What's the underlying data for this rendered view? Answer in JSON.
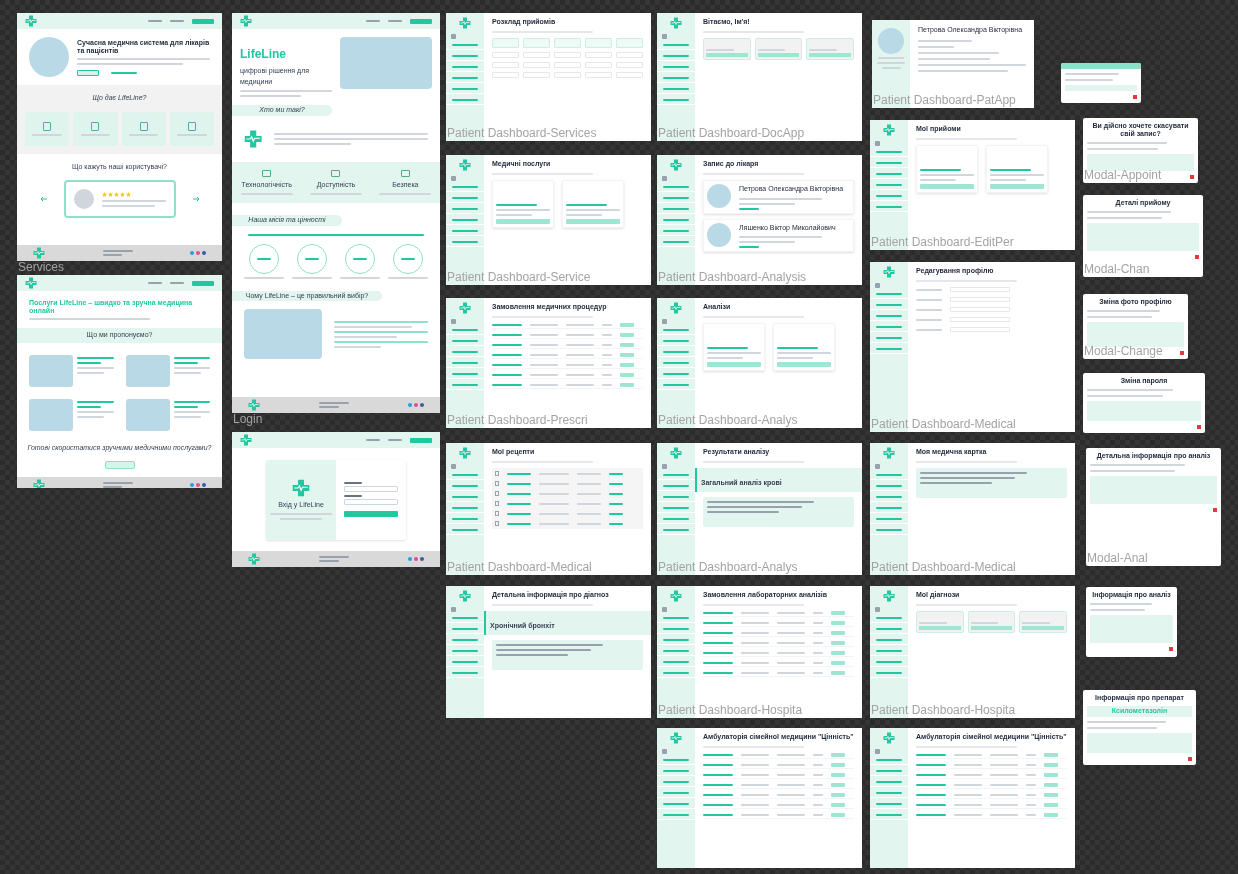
{
  "frames": [
    {
      "kind": "home",
      "label": "Services",
      "title": "Сучасна медична система для лікарів та пацієнтів",
      "section": "Що дає LifeLine?",
      "reviews_title": "Що кажуть наші користувачі?",
      "review": {
        "stars": 5
      }
    },
    {
      "kind": "services",
      "title": "Послуги LifeLine – швидко та зручна медицина онлайн",
      "section": "Що ми пропонуємо?",
      "cta": "Готові скористатися зручними медичними послугами?"
    },
    {
      "kind": "about",
      "label": "Login",
      "brand": "LifeLine",
      "tagline": "цифрові рішення для медицини",
      "who": "Хто ми такі?",
      "features": [
        "Технологічність",
        "Доступність",
        "Безпека"
      ],
      "mission": "Наша місія та цінності",
      "why": "Чому LifeLine – це правильний вибір?"
    },
    {
      "kind": "login",
      "title": "Вхід у LifeLine"
    },
    {
      "kind": "dashboard",
      "label": "Patient Dashboard-Services",
      "title": "Розклад прийомів",
      "panel": {
        "kind": "slots"
      }
    },
    {
      "kind": "dashboard",
      "label": "Patient Dashboard-Service",
      "title": "Медичні послуги",
      "panel": {
        "kind": "cards"
      }
    },
    {
      "kind": "dashboard",
      "label": "Patient Dashboard-Prescri",
      "title": "Замовлення медичних процедур",
      "panel": {
        "kind": "table"
      }
    },
    {
      "kind": "dashboard",
      "label": "Patient Dashboard-Medical",
      "title": "Мої рецепти",
      "panel": {
        "kind": "list"
      }
    },
    {
      "kind": "dashboard",
      "title": "Детальна інформація про діагноз",
      "panel": {
        "kind": "detail"
      },
      "headings": [
        "Хронічний бронхіт"
      ]
    },
    {
      "kind": "dashboard",
      "label": "Patient Dashboard-DocApp",
      "title": "Вітаємо, Ім'я!",
      "panel": {
        "kind": "tiles"
      }
    },
    {
      "kind": "dashboard",
      "label": "Patient Dashboard-Analysis",
      "title": "Запис до лікаря",
      "panel": {
        "kind": "doctors"
      },
      "headings": [
        "Петрова Олександра Вікторівна",
        "Ляшенко Віктор Миколайович"
      ]
    },
    {
      "kind": "dashboard",
      "label": "Patient Dashboard-Analys",
      "title": "Аналізи",
      "panel": {
        "kind": "cards"
      }
    },
    {
      "kind": "dashboard",
      "label": "Patient Dashboard-Analys",
      "title": "Результати аналізу",
      "panel": {
        "kind": "detail"
      },
      "headings": [
        "Загальний аналіз крові"
      ]
    },
    {
      "kind": "dashboard",
      "label": "Patient Dashboard-Hospita",
      "title": "Замовлення лабораторних аналізів",
      "panel": {
        "kind": "table"
      }
    },
    {
      "kind": "dashboard",
      "title": "Амбулаторія сімейної медицини \"Цінність\"",
      "panel": {
        "kind": "table"
      }
    },
    {
      "kind": "profile",
      "label": "Patient Dashboard-PatApp",
      "title": "Петрова Олександра Вікторівна"
    },
    {
      "kind": "dashboard",
      "label": "Patient Dashboard-EditPer",
      "title": "Мої прийоми",
      "panel": {
        "kind": "cards"
      }
    },
    {
      "kind": "dashboard",
      "label": "Patient Dashboard-Medical",
      "title": "Редагування профілю",
      "panel": {
        "kind": "form"
      }
    },
    {
      "kind": "dashboard",
      "label": "Patient Dashboard-Medical",
      "title": "Моя медична картка",
      "panel": {
        "kind": "detail"
      }
    },
    {
      "kind": "dashboard",
      "label": "Patient Dashboard-Hospita",
      "title": "Мої діагнози",
      "panel": {
        "kind": "tiles"
      }
    },
    {
      "kind": "dashboard",
      "title": "Амбулаторія сімейної медицини \"Цінність\"",
      "panel": {
        "kind": "table"
      }
    },
    {
      "kind": "modal"
    },
    {
      "kind": "modal",
      "label": "Modal-Appoint",
      "title": "Ви дійсно хочете скасувати свій запис?"
    },
    {
      "kind": "modal",
      "label": "Modal-Chan",
      "title": "Деталі прийому"
    },
    {
      "kind": "modal",
      "label": "Modal-Change",
      "title": "Зміна фото профілю"
    },
    {
      "kind": "modal",
      "title": "Зміна пароля"
    },
    {
      "kind": "modal",
      "label": "Modal-Anal",
      "title": "Детальна інформація про аналіз"
    },
    {
      "kind": "modal",
      "title": "Інформація про аналіз"
    },
    {
      "kind": "modal",
      "title": "Інформація про препарат",
      "subtitle": "Ксилометазолін"
    }
  ]
}
